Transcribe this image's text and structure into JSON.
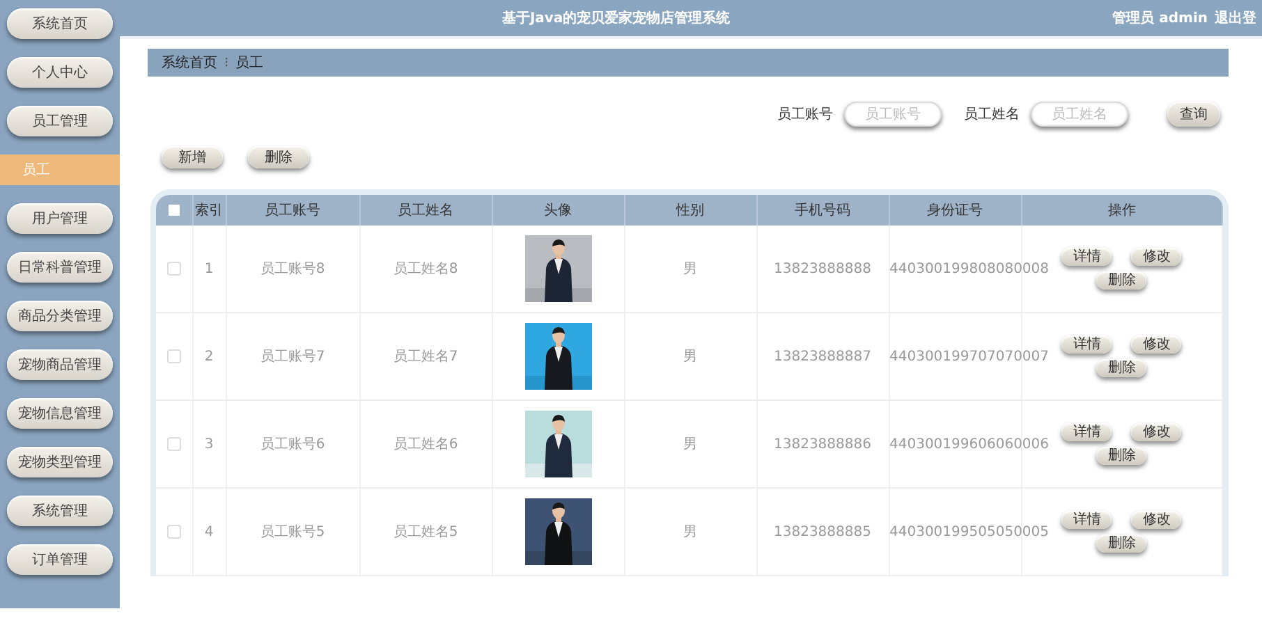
{
  "header": {
    "title": "基于Java的宠贝爱家宠物店管理系统",
    "user_label": "管理员 admin",
    "logout": "退出登"
  },
  "sidebar": {
    "items": [
      {
        "label": "系统首页",
        "kind": "menu",
        "selected": false
      },
      {
        "label": "个人中心",
        "kind": "menu",
        "selected": false
      },
      {
        "label": "员工管理",
        "kind": "menu",
        "selected": false
      },
      {
        "label": "员工",
        "kind": "sub",
        "selected": true
      },
      {
        "label": "用户管理",
        "kind": "menu",
        "selected": false
      },
      {
        "label": "日常科普管理",
        "kind": "menu",
        "selected": false
      },
      {
        "label": "商品分类管理",
        "kind": "menu",
        "selected": false
      },
      {
        "label": "宠物商品管理",
        "kind": "menu",
        "selected": false
      },
      {
        "label": "宠物信息管理",
        "kind": "menu",
        "selected": false
      },
      {
        "label": "宠物类型管理",
        "kind": "menu",
        "selected": false
      },
      {
        "label": "系统管理",
        "kind": "menu",
        "selected": false
      },
      {
        "label": "订单管理",
        "kind": "menu",
        "selected": false
      }
    ]
  },
  "breadcrumb": {
    "items": [
      "系统首页",
      "员工"
    ],
    "separator": "⁝"
  },
  "search": {
    "fields": [
      {
        "label": "员工账号",
        "placeholder": "员工账号"
      },
      {
        "label": "员工姓名",
        "placeholder": "员工姓名"
      }
    ],
    "button": "查询"
  },
  "toolbar": {
    "buttons": [
      "新增",
      "删除"
    ]
  },
  "table": {
    "select_all_checked": false,
    "columns": [
      "索引",
      "员工账号",
      "员工姓名",
      "头像",
      "性别",
      "手机号码",
      "身份证号",
      "操作"
    ],
    "rows": [
      {
        "checked": false,
        "index": "1",
        "account": "员工账号8",
        "name": "员工姓名8",
        "avatar": {
          "kind": "picture"
        },
        "gender": "男",
        "phone": "13823888888",
        "id_number": "440300199808080008",
        "actions": [
          "详情",
          "修改",
          "删除"
        ]
      },
      {
        "checked": false,
        "index": "2",
        "account": "员工账号7",
        "name": "员工姓名7",
        "avatar": {
          "kind": "picture"
        },
        "gender": "男",
        "phone": "13823888887",
        "id_number": "440300199707070007",
        "actions": [
          "详情",
          "修改",
          "删除"
        ]
      },
      {
        "checked": false,
        "index": "3",
        "account": "员工账号6",
        "name": "员工姓名6",
        "avatar": {
          "kind": "picture"
        },
        "gender": "男",
        "phone": "13823888886",
        "id_number": "440300199606060006",
        "actions": [
          "详情",
          "修改",
          "删除"
        ]
      },
      {
        "checked": false,
        "index": "4",
        "account": "员工账号5",
        "name": "员工姓名5",
        "avatar": {
          "kind": "picture"
        },
        "gender": "男",
        "phone": "13823888885",
        "id_number": "440300199505050005",
        "actions": [
          "详情",
          "修改",
          "删除"
        ]
      }
    ]
  }
}
